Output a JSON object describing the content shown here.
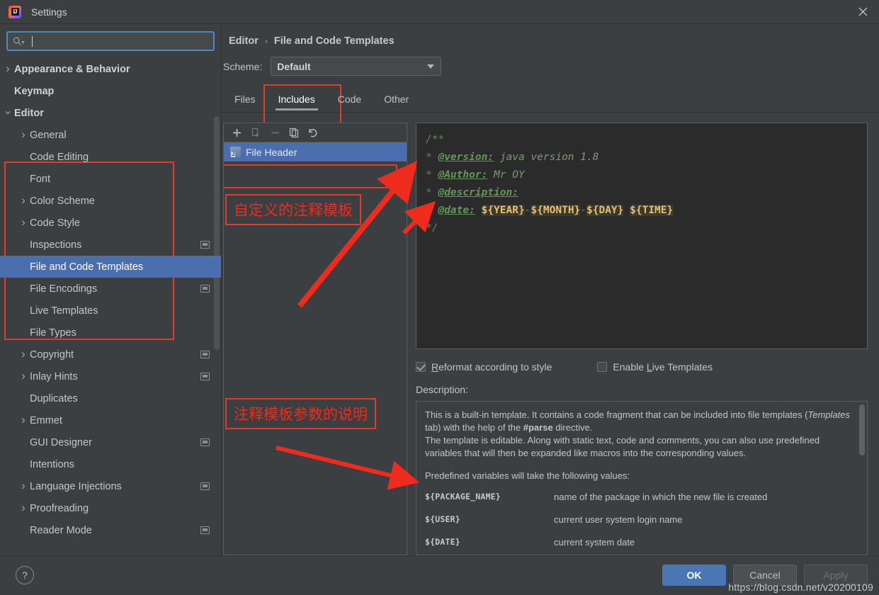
{
  "window": {
    "title": "Settings",
    "app_icon": "intellij-idea-icon",
    "close_icon": "close-icon"
  },
  "search": {
    "placeholder": "",
    "value": "",
    "icon": "search-icon"
  },
  "sidebar": {
    "items": [
      {
        "label": "Appearance & Behavior",
        "level": 1,
        "arrow": "chevron-right",
        "bold": true,
        "badge": false,
        "selected": false
      },
      {
        "label": "Keymap",
        "level": 1,
        "arrow": "",
        "bold": true,
        "badge": false,
        "selected": false
      },
      {
        "label": "Editor",
        "level": 1,
        "arrow": "chevron-down",
        "bold": true,
        "badge": false,
        "selected": false
      },
      {
        "label": "General",
        "level": 2,
        "arrow": "chevron-right",
        "bold": false,
        "badge": false,
        "selected": false
      },
      {
        "label": "Code Editing",
        "level": 2,
        "arrow": "",
        "bold": false,
        "badge": false,
        "selected": false
      },
      {
        "label": "Font",
        "level": 2,
        "arrow": "",
        "bold": false,
        "badge": false,
        "selected": false
      },
      {
        "label": "Color Scheme",
        "level": 2,
        "arrow": "chevron-right",
        "bold": false,
        "badge": false,
        "selected": false
      },
      {
        "label": "Code Style",
        "level": 2,
        "arrow": "chevron-right",
        "bold": false,
        "badge": false,
        "selected": false
      },
      {
        "label": "Inspections",
        "level": 2,
        "arrow": "",
        "bold": false,
        "badge": true,
        "selected": false
      },
      {
        "label": "File and Code Templates",
        "level": 2,
        "arrow": "",
        "bold": false,
        "badge": false,
        "selected": true
      },
      {
        "label": "File Encodings",
        "level": 2,
        "arrow": "",
        "bold": false,
        "badge": true,
        "selected": false
      },
      {
        "label": "Live Templates",
        "level": 2,
        "arrow": "",
        "bold": false,
        "badge": false,
        "selected": false
      },
      {
        "label": "File Types",
        "level": 2,
        "arrow": "",
        "bold": false,
        "badge": false,
        "selected": false
      },
      {
        "label": "Copyright",
        "level": 2,
        "arrow": "chevron-right",
        "bold": false,
        "badge": true,
        "selected": false
      },
      {
        "label": "Inlay Hints",
        "level": 2,
        "arrow": "chevron-right",
        "bold": false,
        "badge": true,
        "selected": false
      },
      {
        "label": "Duplicates",
        "level": 2,
        "arrow": "",
        "bold": false,
        "badge": false,
        "selected": false
      },
      {
        "label": "Emmet",
        "level": 2,
        "arrow": "chevron-right",
        "bold": false,
        "badge": false,
        "selected": false
      },
      {
        "label": "GUI Designer",
        "level": 2,
        "arrow": "",
        "bold": false,
        "badge": true,
        "selected": false
      },
      {
        "label": "Intentions",
        "level": 2,
        "arrow": "",
        "bold": false,
        "badge": false,
        "selected": false
      },
      {
        "label": "Language Injections",
        "level": 2,
        "arrow": "chevron-right",
        "bold": false,
        "badge": true,
        "selected": false
      },
      {
        "label": "Proofreading",
        "level": 2,
        "arrow": "chevron-right",
        "bold": false,
        "badge": false,
        "selected": false
      },
      {
        "label": "Reader Mode",
        "level": 2,
        "arrow": "",
        "bold": false,
        "badge": true,
        "selected": false
      }
    ]
  },
  "breadcrumb": {
    "parent": "Editor",
    "separator": "›",
    "current": "File and Code Templates"
  },
  "scheme": {
    "label": "Scheme:",
    "value": "Default"
  },
  "tabs": [
    {
      "label": "Files",
      "active": false
    },
    {
      "label": "Includes",
      "active": true
    },
    {
      "label": "Code",
      "active": false
    },
    {
      "label": "Other",
      "active": false
    }
  ],
  "list_toolbar": [
    {
      "name": "add-button",
      "icon": "plus-icon",
      "disabled": false
    },
    {
      "name": "copy-template-button",
      "icon": "copy-file-icon",
      "disabled": true
    },
    {
      "name": "remove-button",
      "icon": "minus-icon",
      "disabled": true
    },
    {
      "name": "duplicate-button",
      "icon": "duplicate-icon",
      "disabled": false
    },
    {
      "name": "reset-button",
      "icon": "undo-icon",
      "disabled": false
    }
  ],
  "templates": [
    {
      "name": "File Header",
      "selected": true,
      "icon": "java-template-icon"
    }
  ],
  "editor": {
    "lines": [
      {
        "parts": [
          {
            "t": "/**",
            "c": "c-doc"
          }
        ]
      },
      {
        "parts": [
          {
            "t": "* ",
            "c": "c-doc"
          },
          {
            "t": "@version:",
            "c": "c-tag"
          },
          {
            "t": " java version 1.8",
            "c": "c-txt"
          }
        ]
      },
      {
        "parts": [
          {
            "t": "* ",
            "c": "c-doc"
          },
          {
            "t": "@Author:",
            "c": "c-tag"
          },
          {
            "t": " Mr OY",
            "c": "c-txt"
          }
        ]
      },
      {
        "parts": [
          {
            "t": "* ",
            "c": "c-doc"
          },
          {
            "t": "@description:",
            "c": "c-tag"
          }
        ]
      },
      {
        "parts": [
          {
            "t": "* ",
            "c": "c-doc"
          },
          {
            "t": "@date:",
            "c": "c-tag"
          },
          {
            "t": " ",
            "c": "c-txt"
          },
          {
            "t": "${YEAR}",
            "c": "c-var"
          },
          {
            "t": "-",
            "c": "c-txt"
          },
          {
            "t": "${MONTH}",
            "c": "c-var"
          },
          {
            "t": "-",
            "c": "c-txt"
          },
          {
            "t": "${DAY}",
            "c": "c-var"
          },
          {
            "t": " ",
            "c": "c-txt"
          },
          {
            "t": "${TIME}",
            "c": "c-var"
          }
        ]
      },
      {
        "parts": [
          {
            "t": "*/",
            "c": "c-doc"
          }
        ]
      }
    ]
  },
  "checkboxes": [
    {
      "label_pre": "",
      "accel": "R",
      "label_post": "eformat according to style",
      "checked": true,
      "name": "reformat-checkbox"
    },
    {
      "label_pre": "Enable ",
      "accel": "L",
      "label_post": "ive Templates",
      "checked": false,
      "name": "enable-live-templates-checkbox"
    }
  ],
  "description": {
    "label": "Description:",
    "para1_a": "This is a built-in template. It contains a code fragment that can be included into file templates (",
    "para1_i": "Templates",
    "para1_b": " tab) with the help of the ",
    "para1_bold": "#parse",
    "para1_c": " directive.",
    "para2": "The template is editable. Along with static text, code and comments, you can also use predefined variables that will then be expanded like macros into the corresponding values.",
    "para3": "Predefined variables will take the following values:",
    "variables": [
      {
        "name": "${PACKAGE_NAME}",
        "desc": "name of the package in which the new file is created"
      },
      {
        "name": "${USER}",
        "desc": "current user system login name"
      },
      {
        "name": "${DATE}",
        "desc": "current system date"
      }
    ]
  },
  "annotations": [
    {
      "text": "自定义的注释模板",
      "name": "annotation-custom-comment-template"
    },
    {
      "text": "注释模板参数的说明",
      "name": "annotation-template-parameter-explanation"
    }
  ],
  "footer": {
    "help_icon": "help-icon",
    "ok": "OK",
    "cancel": "Cancel",
    "apply": "Apply"
  },
  "watermark": "https://blog.csdn.net/v20200109",
  "colors": {
    "accent_blue": "#4b6eaf",
    "annotation_red": "#e03c2c",
    "editor_bg": "#2b2b2b",
    "panel_bg": "#3c3f41"
  }
}
